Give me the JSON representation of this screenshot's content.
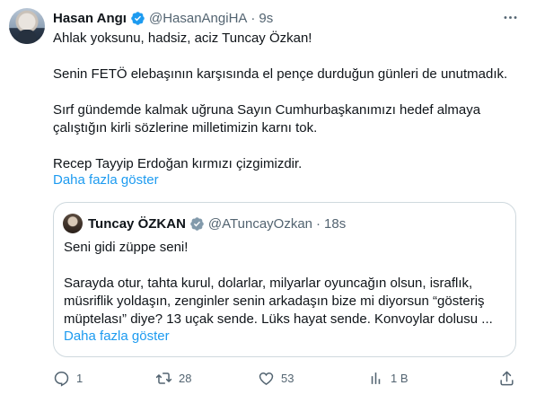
{
  "tweet": {
    "author_name": "Hasan Angı",
    "author_handle": "@HasanAngiHA",
    "separator": "·",
    "time": "9s",
    "lines": [
      "Ahlak yoksunu, hadsiz, aciz Tuncay Özkan!",
      "Senin FETÖ elebaşının karşısında el pençe durduğun günleri de unutmadık.",
      "Sırf gündemde kalmak uğruna Sayın Cumhurbaşkanımızı hedef almaya",
      "çalıştığın kirli sözlerine milletimizin karnı tok.",
      "Recep Tayyip Erdoğan kırmızı çizgimizdir."
    ],
    "show_more": "Daha fazla göster"
  },
  "quote": {
    "author_name": "Tuncay ÖZKAN",
    "author_handle": "@ATuncayOzkan",
    "separator": "·",
    "time": "18s",
    "lines": [
      "Seni gidi züppe seni!",
      "Sarayda otur, tahta kurul, dolarlar, milyarlar oyuncağın olsun, israflık,",
      "müsriflik yoldaşın, zenginler senin arkadaşın bize mi diyorsun “gösteriş",
      "müptelası” diye? 13 uçak sende. Lüks hayat sende. Konvoylar dolusu ..."
    ],
    "show_more": "Daha fazla göster"
  },
  "actions": {
    "replies": "1",
    "retweets": "28",
    "likes": "53",
    "views": "1 B"
  },
  "colors": {
    "link": "#1d9bf0",
    "muted": "#536471",
    "text": "#0f1419",
    "border": "#cfd9de",
    "verified": "#1d9bf0"
  },
  "icons": [
    "verified-badge-icon",
    "more-options-icon",
    "reply-icon",
    "retweet-icon",
    "like-icon",
    "views-icon",
    "share-icon"
  ]
}
